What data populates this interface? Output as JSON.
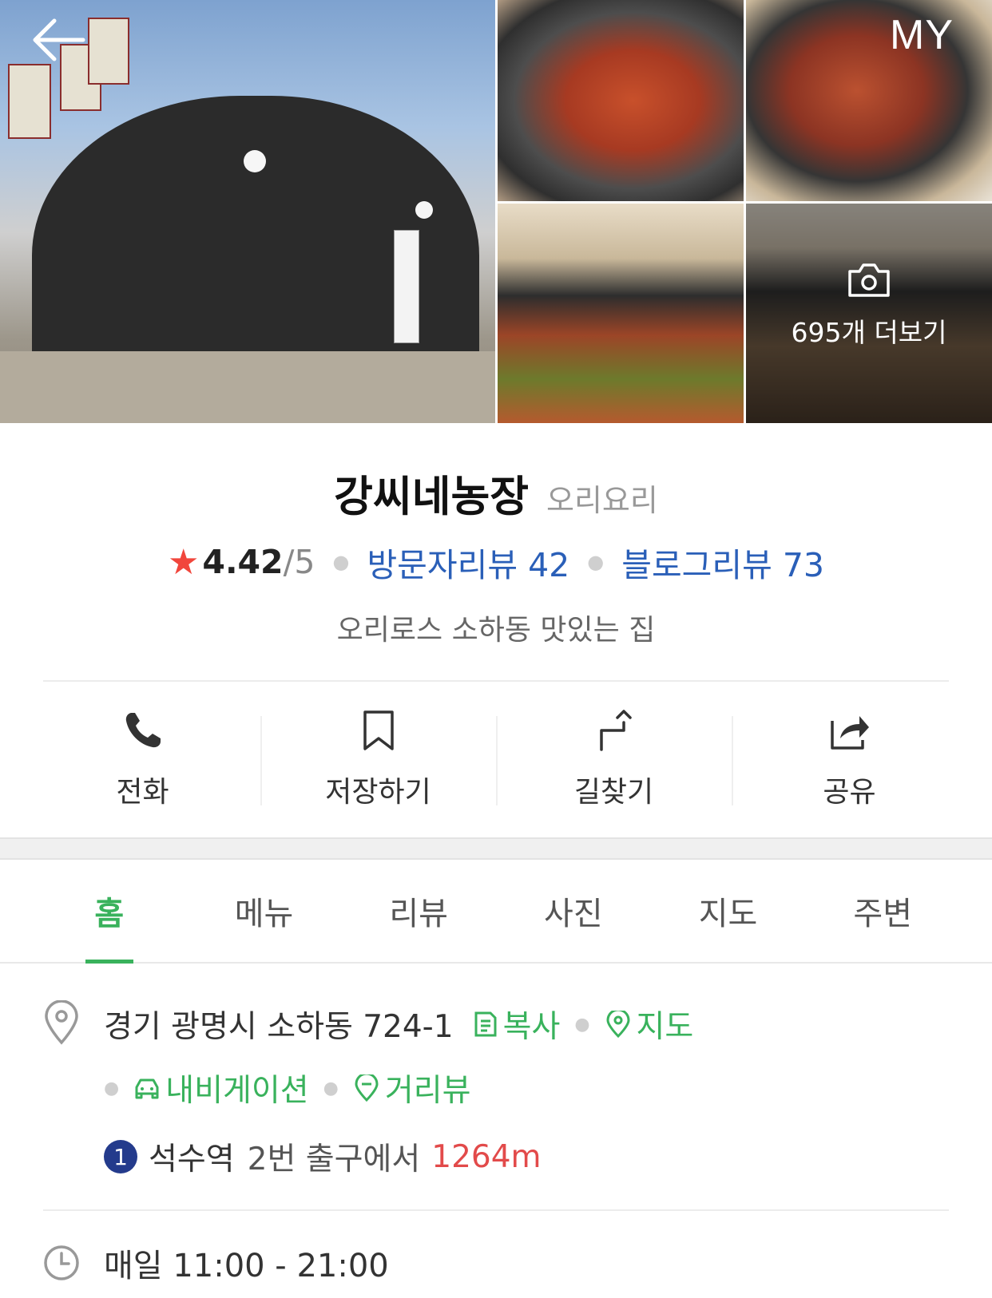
{
  "header": {
    "my_label": "MY",
    "more_photos_label": "695개 더보기"
  },
  "place": {
    "name": "강씨네농장",
    "category": "오리요리",
    "rating": "4.42",
    "rating_max": "/5",
    "visitor_review": "방문자리뷰 42",
    "blog_review": "블로그리뷰 73",
    "description": "오리로스 소하동 맛있는 집"
  },
  "actions": {
    "call": "전화",
    "save": "저장하기",
    "directions": "길찾기",
    "share": "공유"
  },
  "tabs": [
    "홈",
    "메뉴",
    "리뷰",
    "사진",
    "지도",
    "주변"
  ],
  "active_tab": "홈",
  "details": {
    "address": "경기 광명시 소하동 724-1",
    "copy": "복사",
    "map": "지도",
    "navigation": "내비게이션",
    "street_view": "거리뷰",
    "subway_line": "1",
    "station": "석수역",
    "exit": "2번 출구에서",
    "distance": "1264m",
    "hours": "매일 11:00 - 21:00"
  },
  "colors": {
    "accent_green": "#39b25c",
    "link_blue": "#2a5fb8",
    "star_red": "#f1463c",
    "distance_red": "#e24a4a",
    "line1_blue": "#243b8c"
  }
}
